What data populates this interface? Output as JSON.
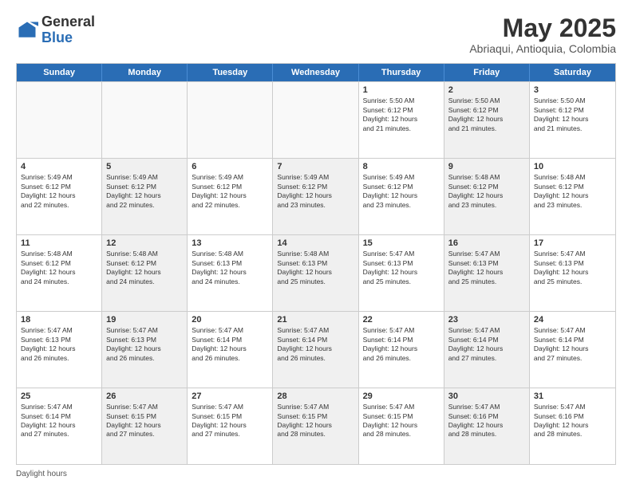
{
  "header": {
    "logo_general": "General",
    "logo_blue": "Blue",
    "month_title": "May 2025",
    "subtitle": "Abriaqui, Antioquia, Colombia"
  },
  "calendar": {
    "days_of_week": [
      "Sunday",
      "Monday",
      "Tuesday",
      "Wednesday",
      "Thursday",
      "Friday",
      "Saturday"
    ],
    "rows": [
      [
        {
          "day": "",
          "empty": true
        },
        {
          "day": "",
          "empty": true
        },
        {
          "day": "",
          "empty": true
        },
        {
          "day": "",
          "empty": true
        },
        {
          "day": "1",
          "info": "Sunrise: 5:50 AM\nSunset: 6:12 PM\nDaylight: 12 hours\nand 21 minutes."
        },
        {
          "day": "2",
          "info": "Sunrise: 5:50 AM\nSunset: 6:12 PM\nDaylight: 12 hours\nand 21 minutes.",
          "shaded": true
        },
        {
          "day": "3",
          "info": "Sunrise: 5:50 AM\nSunset: 6:12 PM\nDaylight: 12 hours\nand 21 minutes."
        }
      ],
      [
        {
          "day": "4",
          "info": "Sunrise: 5:49 AM\nSunset: 6:12 PM\nDaylight: 12 hours\nand 22 minutes."
        },
        {
          "day": "5",
          "info": "Sunrise: 5:49 AM\nSunset: 6:12 PM\nDaylight: 12 hours\nand 22 minutes.",
          "shaded": true
        },
        {
          "day": "6",
          "info": "Sunrise: 5:49 AM\nSunset: 6:12 PM\nDaylight: 12 hours\nand 22 minutes."
        },
        {
          "day": "7",
          "info": "Sunrise: 5:49 AM\nSunset: 6:12 PM\nDaylight: 12 hours\nand 23 minutes.",
          "shaded": true
        },
        {
          "day": "8",
          "info": "Sunrise: 5:49 AM\nSunset: 6:12 PM\nDaylight: 12 hours\nand 23 minutes."
        },
        {
          "day": "9",
          "info": "Sunrise: 5:48 AM\nSunset: 6:12 PM\nDaylight: 12 hours\nand 23 minutes.",
          "shaded": true
        },
        {
          "day": "10",
          "info": "Sunrise: 5:48 AM\nSunset: 6:12 PM\nDaylight: 12 hours\nand 23 minutes."
        }
      ],
      [
        {
          "day": "11",
          "info": "Sunrise: 5:48 AM\nSunset: 6:12 PM\nDaylight: 12 hours\nand 24 minutes."
        },
        {
          "day": "12",
          "info": "Sunrise: 5:48 AM\nSunset: 6:12 PM\nDaylight: 12 hours\nand 24 minutes.",
          "shaded": true
        },
        {
          "day": "13",
          "info": "Sunrise: 5:48 AM\nSunset: 6:13 PM\nDaylight: 12 hours\nand 24 minutes."
        },
        {
          "day": "14",
          "info": "Sunrise: 5:48 AM\nSunset: 6:13 PM\nDaylight: 12 hours\nand 25 minutes.",
          "shaded": true
        },
        {
          "day": "15",
          "info": "Sunrise: 5:47 AM\nSunset: 6:13 PM\nDaylight: 12 hours\nand 25 minutes."
        },
        {
          "day": "16",
          "info": "Sunrise: 5:47 AM\nSunset: 6:13 PM\nDaylight: 12 hours\nand 25 minutes.",
          "shaded": true
        },
        {
          "day": "17",
          "info": "Sunrise: 5:47 AM\nSunset: 6:13 PM\nDaylight: 12 hours\nand 25 minutes."
        }
      ],
      [
        {
          "day": "18",
          "info": "Sunrise: 5:47 AM\nSunset: 6:13 PM\nDaylight: 12 hours\nand 26 minutes."
        },
        {
          "day": "19",
          "info": "Sunrise: 5:47 AM\nSunset: 6:13 PM\nDaylight: 12 hours\nand 26 minutes.",
          "shaded": true
        },
        {
          "day": "20",
          "info": "Sunrise: 5:47 AM\nSunset: 6:14 PM\nDaylight: 12 hours\nand 26 minutes."
        },
        {
          "day": "21",
          "info": "Sunrise: 5:47 AM\nSunset: 6:14 PM\nDaylight: 12 hours\nand 26 minutes.",
          "shaded": true
        },
        {
          "day": "22",
          "info": "Sunrise: 5:47 AM\nSunset: 6:14 PM\nDaylight: 12 hours\nand 26 minutes."
        },
        {
          "day": "23",
          "info": "Sunrise: 5:47 AM\nSunset: 6:14 PM\nDaylight: 12 hours\nand 27 minutes.",
          "shaded": true
        },
        {
          "day": "24",
          "info": "Sunrise: 5:47 AM\nSunset: 6:14 PM\nDaylight: 12 hours\nand 27 minutes."
        }
      ],
      [
        {
          "day": "25",
          "info": "Sunrise: 5:47 AM\nSunset: 6:14 PM\nDaylight: 12 hours\nand 27 minutes."
        },
        {
          "day": "26",
          "info": "Sunrise: 5:47 AM\nSunset: 6:15 PM\nDaylight: 12 hours\nand 27 minutes.",
          "shaded": true
        },
        {
          "day": "27",
          "info": "Sunrise: 5:47 AM\nSunset: 6:15 PM\nDaylight: 12 hours\nand 27 minutes."
        },
        {
          "day": "28",
          "info": "Sunrise: 5:47 AM\nSunset: 6:15 PM\nDaylight: 12 hours\nand 28 minutes.",
          "shaded": true
        },
        {
          "day": "29",
          "info": "Sunrise: 5:47 AM\nSunset: 6:15 PM\nDaylight: 12 hours\nand 28 minutes."
        },
        {
          "day": "30",
          "info": "Sunrise: 5:47 AM\nSunset: 6:16 PM\nDaylight: 12 hours\nand 28 minutes.",
          "shaded": true
        },
        {
          "day": "31",
          "info": "Sunrise: 5:47 AM\nSunset: 6:16 PM\nDaylight: 12 hours\nand 28 minutes."
        }
      ]
    ]
  },
  "footer": {
    "text": "Daylight hours"
  }
}
